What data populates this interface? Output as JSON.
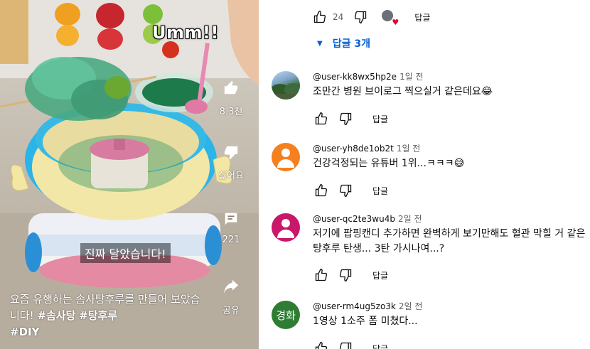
{
  "video": {
    "overlay_text": "Umm!!",
    "subtitle": "진짜 달았습니다!",
    "description": "요즘 유행하는 솜사탕후루를 만들어 보았습니다!",
    "hashtags": [
      "#솜사탕",
      "#탕후루",
      "#DIY"
    ],
    "actions": {
      "like_count": "8.3천",
      "dislike_label": "싫어요",
      "comment_count": "221",
      "share_label": "공유"
    }
  },
  "comments_panel": {
    "top_actions": {
      "like_count": "24",
      "reply_label": "답글"
    },
    "replies_toggle": "답글 3개",
    "comments": [
      {
        "author": "@user-kk8wx5hp2e",
        "time": "1일 전",
        "text": "조만간 병원 브이로그 찍으실거 같은데요😂",
        "reply_label": "답글",
        "avatar": "photo"
      },
      {
        "author": "@user-yh8de1ob2t",
        "time": "1일 전",
        "text": "건강걱정되는 유튜버 1위...ㅋㅋㅋ😅",
        "reply_label": "답글",
        "avatar": "default-orange"
      },
      {
        "author": "@user-qc2te3wu4b",
        "time": "2일 전",
        "text": "저기에 팝핑캔디 추가하면 완벽하게 보기만해도 혈관 막힐 거 같은 탕후루 탄생... 3탄 가시나여...?",
        "reply_label": "답글",
        "avatar": "default-pink"
      },
      {
        "author": "@user-rm4ug5zo3k",
        "time": "2일 전",
        "text": "1영상 1소주 폼 미쳤다...",
        "reply_label": "답글",
        "avatar": "text",
        "avatar_text": "경화"
      }
    ]
  },
  "colors": {
    "link_blue": "#065fd4",
    "heart_red": "#e1002d",
    "secondary_text": "#606060"
  }
}
